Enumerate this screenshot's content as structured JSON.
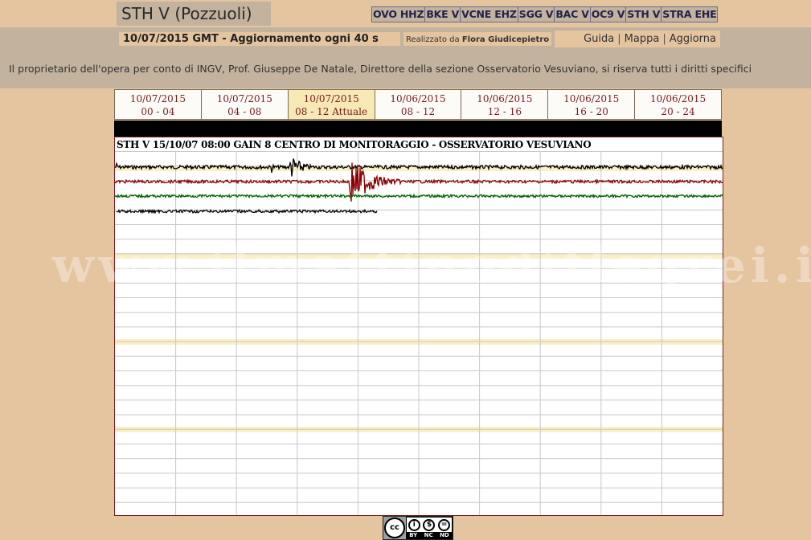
{
  "header": {
    "title": "STH V (Pozzuoli)",
    "stations": [
      "OVO HHZ",
      "BKE V",
      "VCNE EHZ",
      "SGG V",
      "BAC V",
      "OC9 V",
      "STH V",
      "STRA EHE"
    ],
    "date_info": "10/07/2015 GMT - Aggiornamento ogni 40 s",
    "credit_prefix": "Realizzato da",
    "credit_name": "Flora Giudicepietro",
    "links": [
      "Guida",
      "Mappa",
      "Aggiorna"
    ]
  },
  "notice": "Il proprietario dell'opera per conto di INGV, Prof. Giuseppe De Natale, Direttore della sezione Osservatorio Vesuviano, si riserva tutti i diritti specifici",
  "tabs": [
    {
      "date": "10/07/2015",
      "range": "00 - 04",
      "active": false
    },
    {
      "date": "10/07/2015",
      "range": "04 - 08",
      "active": false
    },
    {
      "date": "10/07/2015",
      "range": "08 - 12 Attuale",
      "active": true
    },
    {
      "date": "10/06/2015",
      "range": "08 - 12",
      "active": false
    },
    {
      "date": "10/06/2015",
      "range": "12 - 16",
      "active": false
    },
    {
      "date": "10/06/2015",
      "range": "16 - 20",
      "active": false
    },
    {
      "date": "10/06/2015",
      "range": "20 - 24",
      "active": false
    }
  ],
  "seismogram": {
    "title": "STH V 15/10/07 08:00 GAIN  8  CENTRO DI MONITORAGGIO - OSSERVATORIO VESUVIANO",
    "trace_colors": [
      "#000000",
      "#8b0000",
      "#006400",
      "#000000"
    ],
    "highlight_color": "#fbefc4",
    "grid_color": "#c8c8c8"
  },
  "watermark": "www.ilmattinodiflegrei.it",
  "license": {
    "badge": "cc",
    "icons": [
      "by-icon",
      "nc-icon",
      "nd-icon"
    ],
    "terms": [
      "BY",
      "NC",
      "ND"
    ]
  }
}
